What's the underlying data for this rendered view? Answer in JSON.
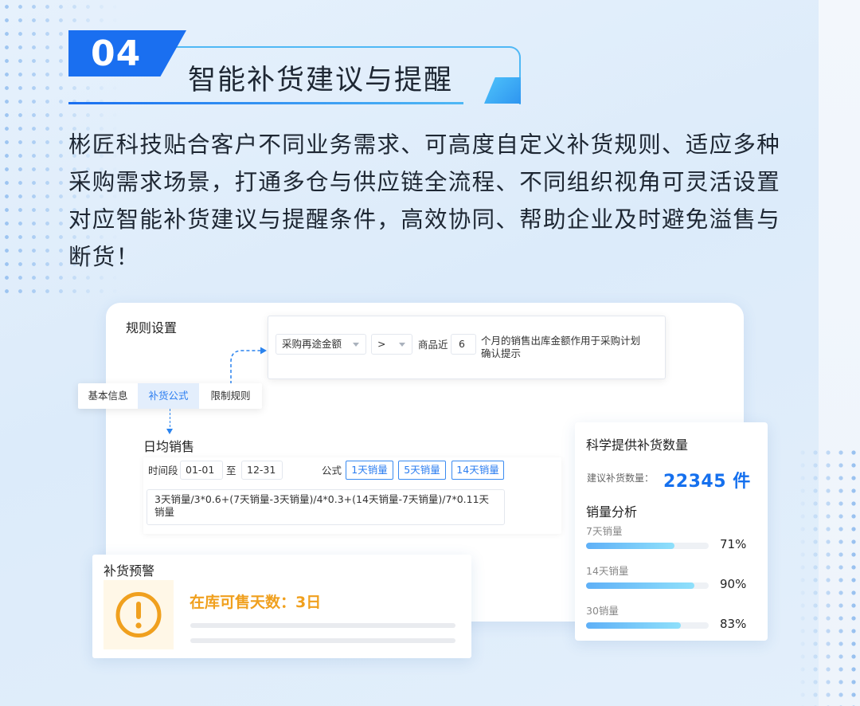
{
  "header": {
    "number": "04",
    "title": "智能补货建议与提醒"
  },
  "intro": "彬匠科技贴合客户不同业务需求、可高度自定义补货规则、适应多种采购需求场景，打通多仓与供应链全流程、不同组织视角可灵活设置对应智能补货建议与提醒条件，高效协同、帮助企业及时避免溢售与断货！",
  "rules": {
    "title": "规则设置",
    "metric_select": "采购再途金额",
    "operator_select": ">",
    "goods_recent_label": "商品近",
    "months_value": "6",
    "condition_text": "个月的销售出库金额作用于采购计划确认提示"
  },
  "tabs": [
    {
      "label": "基本信息",
      "active": false
    },
    {
      "label": "补货公式",
      "active": true
    },
    {
      "label": "限制规则",
      "active": false
    }
  ],
  "daily_sales": {
    "title": "日均销售",
    "period_label": "时间段",
    "start": "01-01",
    "to_label": "至",
    "end": "12-31",
    "formula_label": "公式",
    "chips": [
      "1天销量",
      "5天销量",
      "14天销量"
    ],
    "formula": "3天销量/3*0.6+(7天销量-3天销量)/4*0.3+(14天销量-7天销量)/7*0.11天销量"
  },
  "suggestion": {
    "title": "科学提供补货数量",
    "qty_label": "建议补货数量：",
    "qty_value": "22345 件",
    "analysis_title": "销量分析",
    "bars": [
      {
        "label": "7天销量",
        "percent_text": "71%",
        "fill": 0.72
      },
      {
        "label": "14天销量",
        "percent_text": "90%",
        "fill": 0.88
      },
      {
        "label": "30销量",
        "percent_text": "83%",
        "fill": 0.77
      }
    ]
  },
  "warning": {
    "title": "补货预警",
    "message": "在库可售天数：3日",
    "icon": "exclamation-circle-icon",
    "color": "#f0a01e"
  },
  "colors": {
    "brand_blue": "#1a6ff0",
    "accent_cyan": "#4fb8f5",
    "number_blue": "#1570ee"
  }
}
